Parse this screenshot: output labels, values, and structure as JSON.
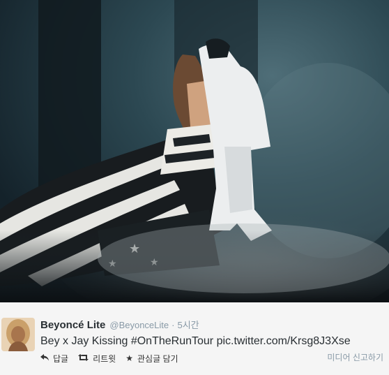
{
  "tweet": {
    "display_name": "Beyoncé Lite",
    "handle": "@BeyonceLite",
    "separator": "·",
    "time": "5시간",
    "text": "Bey x Jay Kissing #OnTheRunTour pic.twitter.com/Krsg8J3Xse"
  },
  "actions": {
    "reply_label": "답글",
    "retweet_label": "리트윗",
    "favorite_label": "관심글 담기",
    "media_link_label": "미디어 신고하기"
  },
  "icons": {
    "reply": "reply-icon",
    "retweet": "retweet-icon",
    "favorite": "star-icon"
  },
  "colors": {
    "tweet_background": "#f5f5f5",
    "secondary_text": "#8899a6",
    "primary_text": "#292f33"
  }
}
